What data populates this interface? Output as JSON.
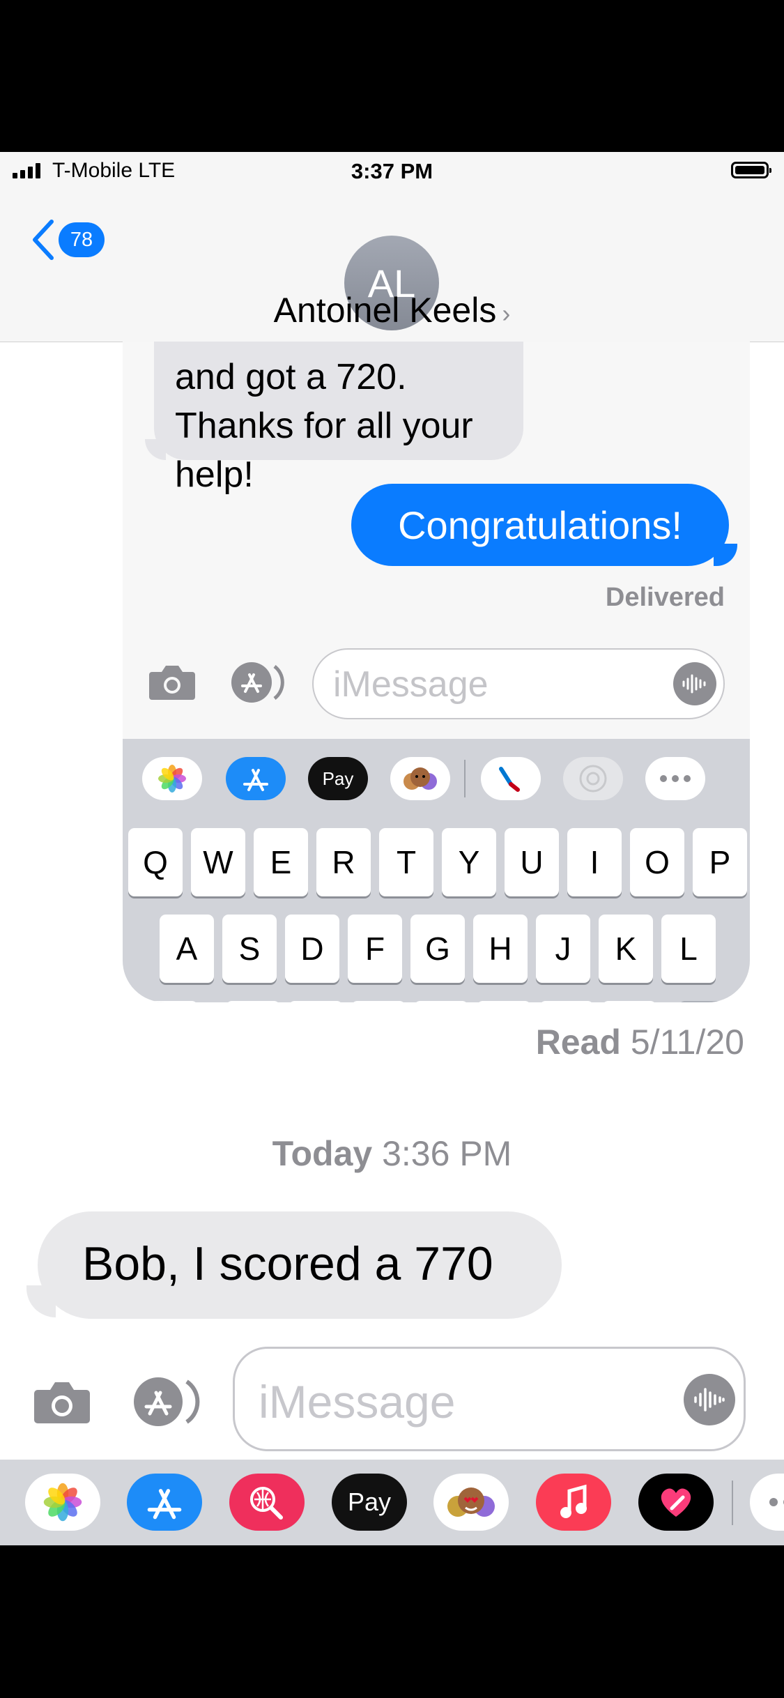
{
  "status_bar": {
    "carrier": "T-Mobile   LTE",
    "time": "3:37 PM"
  },
  "header": {
    "back_badge": "78",
    "avatar_initials": "AL",
    "contact_name": "Antoinel Keels"
  },
  "screenshot_embed": {
    "received_text": "and got a 720. Thanks for all your help!",
    "sent_text": "Congratulations!",
    "delivery_status": "Delivered",
    "input_placeholder": "iMessage",
    "tray_icons": [
      "photos-icon",
      "app-store-icon",
      "apple-pay-icon",
      "memoji-icon",
      "american-airlines-icon",
      "digital-touch-icon",
      "more-icon"
    ],
    "keyboard_rows": [
      [
        "Q",
        "W",
        "E",
        "R",
        "T",
        "Y",
        "U",
        "I",
        "O",
        "P"
      ],
      [
        "A",
        "S",
        "D",
        "F",
        "G",
        "H",
        "J",
        "K",
        "L"
      ]
    ]
  },
  "thread": {
    "read_label": "Read",
    "read_date": "5/11/20",
    "day_label": "Today",
    "day_time": "3:36 PM",
    "incoming_message": "Bob, I scored a 770"
  },
  "composer": {
    "placeholder": "iMessage"
  },
  "app_tray": {
    "items": [
      "photos-icon",
      "app-store-icon",
      "web-images-icon",
      "apple-pay-icon",
      "memoji-icon",
      "music-icon",
      "digital-touch-icon",
      "more-icon"
    ],
    "apple_pay_label": "Pay"
  },
  "colors": {
    "accent": "#0a7cff",
    "bubble_gray": "#e9e9eb",
    "meta_gray": "#8e8e93",
    "music_red": "#fb3c55",
    "web_red": "#ef2f5c"
  }
}
